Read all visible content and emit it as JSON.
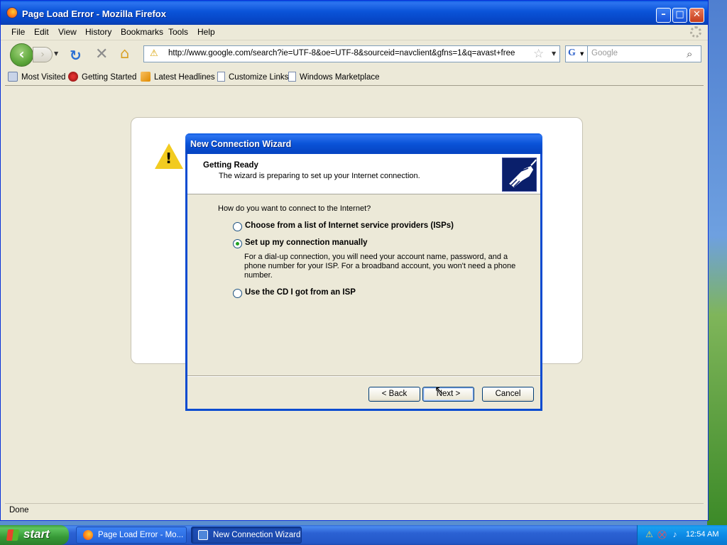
{
  "browser": {
    "title": "Page Load Error - Mozilla Firefox",
    "menu": [
      "File",
      "Edit",
      "View",
      "History",
      "Bookmarks",
      "Tools",
      "Help"
    ],
    "url": "http://www.google.com/search?ie=UTF-8&oe=UTF-8&sourceid=navclient&gfns=1&q=avast+free",
    "search_engine_letter": "G",
    "search_placeholder": "Google",
    "bookmarks": [
      "Most Visited",
      "Getting Started",
      "Latest Headlines",
      "Customize Links",
      "Windows Marketplace"
    ],
    "status": "Done"
  },
  "wizard": {
    "title": "New Connection Wizard",
    "header_title": "Getting Ready",
    "header_subtitle": "The wizard is preparing to set up your Internet connection.",
    "question": "How do you want to connect to the Internet?",
    "options": [
      {
        "label": "Choose from a list of Internet service providers (ISPs)",
        "selected": false
      },
      {
        "label": "Set up my connection manually",
        "selected": true
      },
      {
        "label": "Use the CD I got from an ISP",
        "selected": false
      }
    ],
    "manual_description": "For a dial-up connection, you will need your account name, password, and a phone number for your ISP. For a broadband account, you won't need a phone number.",
    "buttons": {
      "back": "< Back",
      "next": "Next >",
      "cancel": "Cancel"
    }
  },
  "taskbar": {
    "start": "start",
    "tasks": [
      "Page Load Error - Mo...",
      "New Connection Wizard"
    ],
    "time": "12:54 AM"
  },
  "icons": {
    "warning": "warning-icon",
    "reload": "reload-icon",
    "stop": "stop-icon",
    "home": "home-icon",
    "bookmark_star": "star-icon"
  }
}
